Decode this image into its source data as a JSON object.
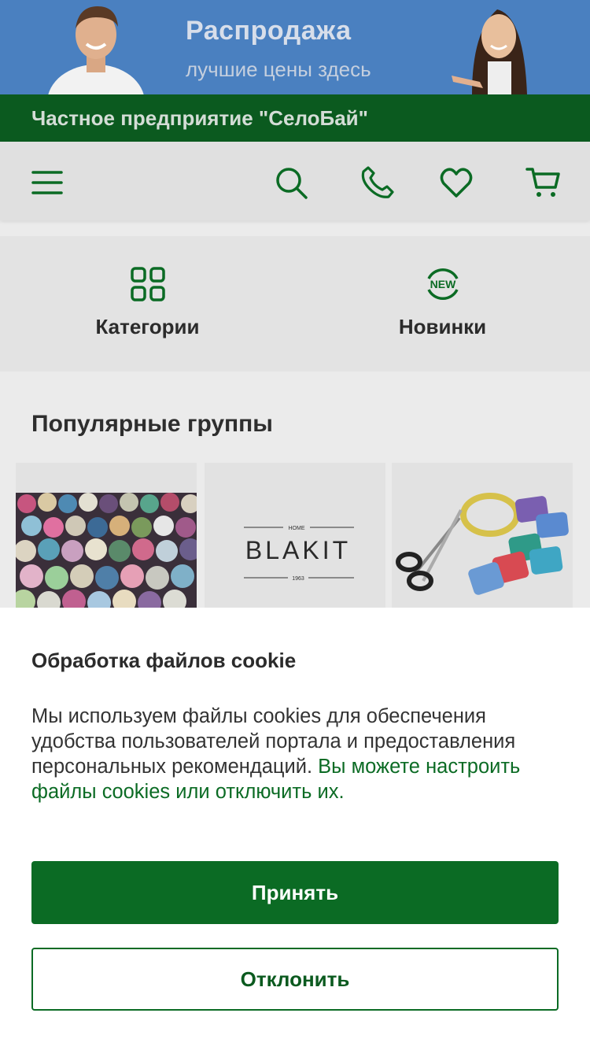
{
  "banner": {
    "title": "Распродажа",
    "subtitle": "лучшие цены здесь"
  },
  "company": {
    "name": "Частное предприятие \"СелоБай\""
  },
  "header": {
    "icons": [
      "menu-icon",
      "search-icon",
      "phone-icon",
      "heart-icon",
      "cart-icon"
    ]
  },
  "quick_links": [
    {
      "label": "Категории",
      "icon": "grid-icon"
    },
    {
      "label": "Новинки",
      "icon": "new-badge-icon",
      "badge_text": "NEW"
    }
  ],
  "popular": {
    "title": "Популярные группы",
    "cards": [
      {
        "name": "fabric-rolls-image"
      },
      {
        "name": "blakit-logo-image",
        "logo_top": "HOME",
        "logo": "BLAKIT",
        "logo_bottom": "1963"
      },
      {
        "name": "sewing-supplies-image"
      }
    ]
  },
  "cookie": {
    "title": "Обработка файлов cookie",
    "text": "Мы используем файлы cookies для обеспечения удобства пользователей портала и предоставления персональных рекомендаций. ",
    "link_text": "Вы можете настроить файлы cookies или отключить их.",
    "accept_label": "Принять",
    "reject_label": "Отклонить"
  },
  "colors": {
    "brand_green": "#0b6b24",
    "dark_green": "#0b5a1f",
    "banner_blue": "#4a80c0"
  }
}
